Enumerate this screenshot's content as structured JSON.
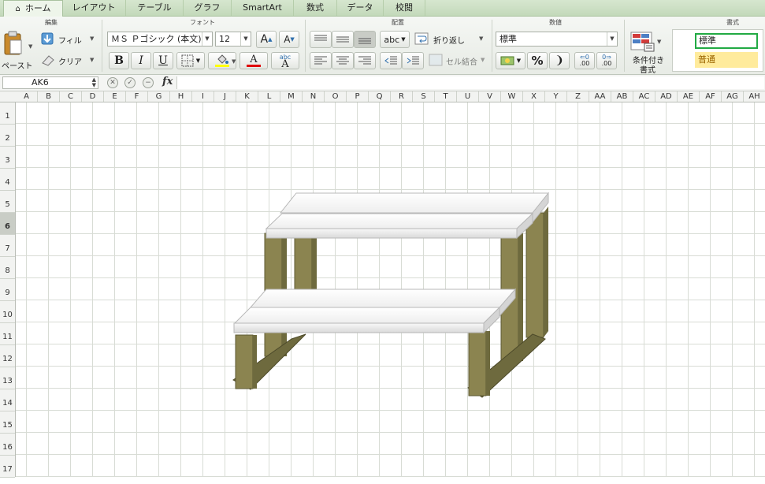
{
  "tabs": [
    {
      "label": "ホーム",
      "active": true
    },
    {
      "label": "レイアウト"
    },
    {
      "label": "テーブル"
    },
    {
      "label": "グラフ"
    },
    {
      "label": "SmartArt"
    },
    {
      "label": "数式"
    },
    {
      "label": "データ"
    },
    {
      "label": "校閲"
    }
  ],
  "ribbon": {
    "groups": {
      "edit": "編集",
      "font": "フォント",
      "alignment": "配置",
      "number": "数値",
      "style": "書式"
    },
    "paste_label": "ペースト",
    "fill_label": "フィル",
    "clear_label": "クリア",
    "font_name": "ＭＳ Ｐゴシック (本文)",
    "font_size": "12",
    "bold": "B",
    "italic": "I",
    "underline": "U",
    "grow_font": "A",
    "shrink_font": "A",
    "font_color_glyph": "A",
    "phonetic_top": "abc",
    "phonetic_bottom": "A",
    "orientation_label": "abc",
    "wrap_label": "折り返し",
    "merge_label": "セル結合",
    "number_format": "標準",
    "percent": "%",
    "comma": "❩",
    "inc_decimal": ".00",
    "dec_decimal": ".00",
    "conditional_format_line1": "条件付き",
    "conditional_format_line2": "書式",
    "style_normal": "標準",
    "style_neutral": "普通",
    "colors": {
      "fill_swatch": "#ffff00",
      "font_swatch": "#e00000",
      "neutral_bg": "#ffeb9c",
      "normal_border": "#22aa44"
    }
  },
  "formula_bar": {
    "name_box": "AK6",
    "fx": "fx",
    "formula": ""
  },
  "columns": [
    "A",
    "B",
    "C",
    "D",
    "E",
    "F",
    "G",
    "H",
    "I",
    "J",
    "K",
    "L",
    "M",
    "N",
    "O",
    "P",
    "Q",
    "R",
    "S",
    "T",
    "U",
    "V",
    "W",
    "X",
    "Y",
    "Z",
    "AA",
    "AB",
    "AC",
    "AD",
    "AE",
    "AF",
    "AG",
    "AH"
  ],
  "rows": [
    "1",
    "2",
    "3",
    "4",
    "5",
    "6",
    "7",
    "8",
    "9",
    "10",
    "11",
    "12",
    "13",
    "14",
    "15",
    "16",
    "17"
  ],
  "selected_row": "6",
  "drawing": {
    "colors": {
      "wood": "#8b8450",
      "wood_dark": "#6e6a3e",
      "board": "#f7f7f7",
      "board_edge": "#c8c8c8"
    }
  }
}
